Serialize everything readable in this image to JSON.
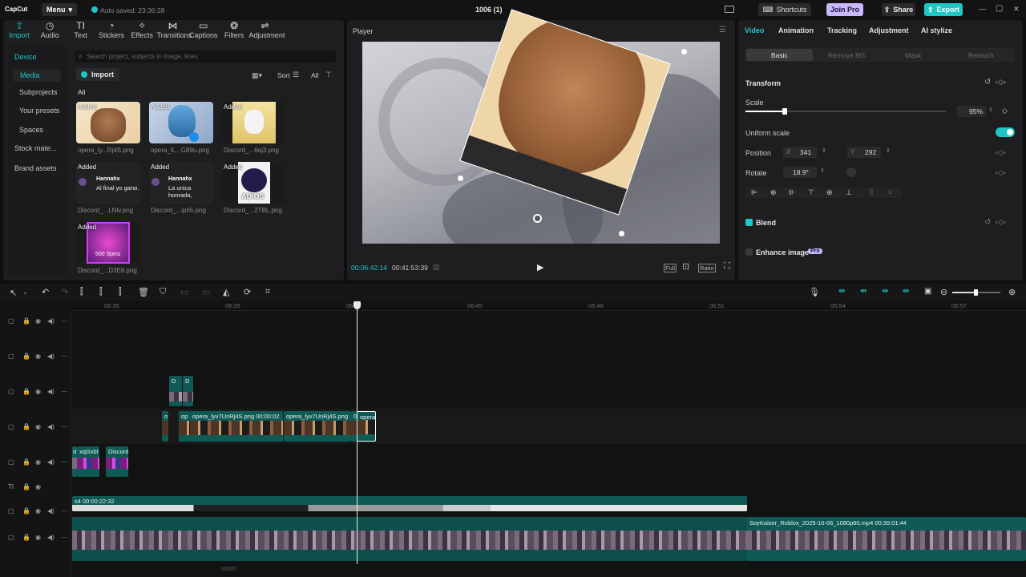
{
  "titlebar": {
    "logo": "CapCut",
    "menu": "Menu",
    "menu_chevron": "▾",
    "autosave": "Auto saved: 23:36:28",
    "project": "1006 (1)",
    "layout_icon": "layout-icon",
    "shortcuts": "Shortcuts",
    "join_pro": "Join Pro",
    "share": "Share",
    "export": "Export",
    "win_min": "—",
    "win_max": "▢",
    "win_close": "✕"
  },
  "toolbar": [
    {
      "label": "Import",
      "icon": "⇪"
    },
    {
      "label": "Audio",
      "icon": "◷"
    },
    {
      "label": "Text",
      "icon": "TI"
    },
    {
      "label": "Stickers",
      "icon": "◔"
    },
    {
      "label": "Effects",
      "icon": "✧"
    },
    {
      "label": "Transitions",
      "icon": "⋈"
    },
    {
      "label": "Captions",
      "icon": "▭"
    },
    {
      "label": "Filters",
      "icon": "❂"
    },
    {
      "label": "Adjustment",
      "icon": "⇌"
    }
  ],
  "sidebar": [
    "Device",
    "Media",
    "Subprojects",
    "Your presets",
    "Spaces",
    "Stock mate...",
    "Brand assets"
  ],
  "search_placeholder": "Search project, subjects in image, lines",
  "import": "Import",
  "sort": "Sort",
  "all_filter": "All",
  "all_label": "All",
  "media": [
    {
      "added": "Added",
      "name": "opera_ly...Rj4S.png"
    },
    {
      "added": "Added",
      "name": "opera_lL...G89u.png"
    },
    {
      "added": "Added",
      "name": "Discord_...6oj3.png"
    },
    {
      "added": "Added",
      "name": "Discord_...LNlv.png",
      "chat_user": "Hannahx",
      "chat_text": "Al final yo gano."
    },
    {
      "added": "Added",
      "name": "Discord_...iph5.png",
      "chat_user": "Hannahx",
      "chat_text": "La unica honrada,"
    },
    {
      "added": "Added",
      "name": "Discord_...2TBL.png",
      "overlay": "ADIOS"
    },
    {
      "added": "Added",
      "name": "Discord_...D3E8.png",
      "overlay": "500 Spins"
    }
  ],
  "player": {
    "title": "Player",
    "time_current": "00:06:42:14",
    "time_total": "00:41:53:39",
    "full": "Full",
    "ratio": "Ratio"
  },
  "props": {
    "tabs": [
      "Video",
      "Animation",
      "Tracking",
      "Adjustment",
      "AI stylize"
    ],
    "subtabs": [
      "Basic",
      "Remove BG",
      "Mask",
      "Retouch"
    ],
    "transform": "Transform",
    "scale_label": "Scale",
    "scale_value": "95%",
    "scale_fraction": 0.95,
    "uniform_scale": "Uniform scale",
    "position": "Position",
    "pos_x_label": "X",
    "pos_x": "341",
    "pos_y_label": "Y",
    "pos_y": "292",
    "rotate": "Rotate",
    "rotate_value": "18.9°",
    "blend": "Blend",
    "enhance": "Enhance image",
    "pro_badge": "Pro"
  },
  "timeline": {
    "ruler": [
      "06:36",
      "06:39",
      "06:42",
      "06:45",
      "06:48",
      "06:51",
      "06:54",
      "06:57"
    ],
    "clips": {
      "c1": "D",
      "c2": "D",
      "c3": "o",
      "c4": "op",
      "c5": "opera_lyv7UnRj4S.png   00:00:02",
      "c6": "opera_lyv7UnRj4S.png",
      "c7": "0",
      "c8": "opera",
      "c9": "d",
      "c10": "xqGxbl",
      "c11": "Discord",
      "c12": "s4  00:00:22:32",
      "c13": "SoyKaiser_Roblox_2025-10-06_1080p60.mp4   00:35:01:44"
    }
  },
  "colors": {
    "accent": "#1fc6c6",
    "clip": "#0f5a55",
    "pro": "#c9b8ff"
  }
}
